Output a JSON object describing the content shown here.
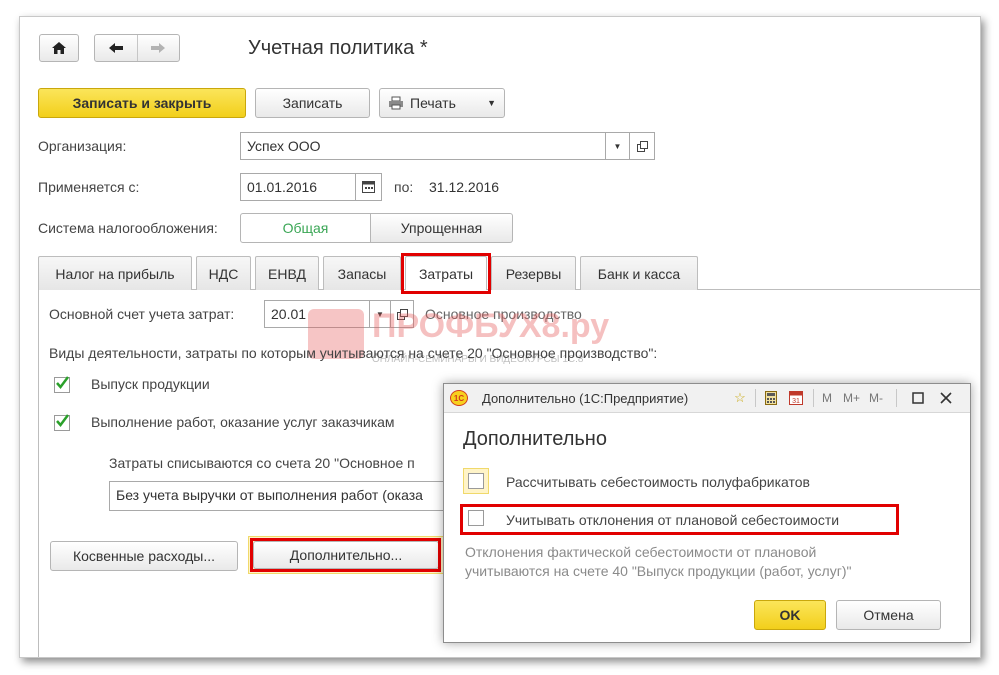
{
  "window": {
    "title": "Учетная политика *"
  },
  "toolbar": {
    "home_icon": "home-icon",
    "back_icon": "arrow-left-icon",
    "forward_icon": "arrow-right-icon",
    "save_close_label": "Записать и закрыть",
    "save_label": "Записать",
    "print_label": "Печать"
  },
  "form": {
    "org_label": "Организация:",
    "org_value": "Успех ООО",
    "applies_label": "Применяется с:",
    "applies_value": "01.01.2016",
    "to_label": "по:",
    "to_value": "31.12.2016",
    "tax_label": "Система налогообложения:",
    "tax_options": [
      "Общая",
      "Упрощенная"
    ],
    "tax_selected": "Общая"
  },
  "tabs": [
    "Налог на прибыль",
    "НДС",
    "ЕНВД",
    "Запасы",
    "Затраты",
    "Резервы",
    "Банк и касса"
  ],
  "active_tab": "Затраты",
  "costs": {
    "account_label": "Основной счет учета затрат:",
    "account_value": "20.01",
    "account_name": "Основное производство",
    "activities_label": "Виды деятельности, затраты по которым учитываются на счете 20 \"Основное производство\":",
    "activity_1": "Выпуск продукции",
    "activity_2": "Выполнение работ, оказание услуг заказчикам",
    "writeoff_label": "Затраты списываются со счета 20 \"Основное п",
    "writeoff_value": "Без учета выручки от выполнения работ (оказа",
    "indirect_button": "Косвенные расходы...",
    "additional_button": "Дополнительно..."
  },
  "watermark": {
    "brand": "ПРОФБУХ8.ру",
    "tagline": "ОНЛАЙН-СЕМИНАРЫ И ВИДЕОКУРСЫ 1С:8"
  },
  "dialog": {
    "title": "Дополнительно (1С:Предприятие)",
    "heading": "Дополнительно",
    "option_1": "Рассчитывать себестоимость полуфабрикатов",
    "option_2": "Учитывать отклонения от плановой себестоимости",
    "hint_line_1": "Отклонения фактической себестоимости от плановой",
    "hint_line_2": "учитываются на счете 40 \"Выпуск продукции (работ, услуг)\"",
    "ok_label": "OK",
    "cancel_label": "Отмена",
    "m_label": "M",
    "mplus_label": "M+",
    "mminus_label": "M-",
    "logo_text": "1С"
  },
  "colors": {
    "accent_yellow": "#f2cf1b",
    "highlight_red": "#e10000",
    "check_green": "#2aa02a",
    "active_tax": "#3aa655"
  }
}
